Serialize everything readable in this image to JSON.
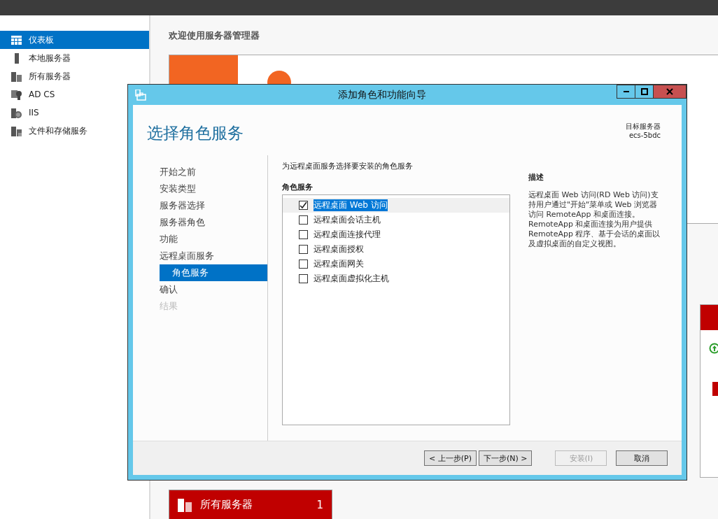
{
  "sidebar": {
    "items": [
      {
        "label": "仪表板",
        "selected": true
      },
      {
        "label": "本地服务器",
        "selected": false
      },
      {
        "label": "所有服务器",
        "selected": false
      },
      {
        "label": "AD CS",
        "selected": false
      },
      {
        "label": "IIS",
        "selected": false
      },
      {
        "label": "文件和存储服务",
        "selected": false
      }
    ]
  },
  "welcome": {
    "title": "欢迎使用服务器管理器"
  },
  "tiles": [
    {
      "title": "所有服务器",
      "count": "1"
    }
  ],
  "dialog": {
    "title": "添加角色和功能向导",
    "heading": "选择角色服务",
    "target_label": "目标服务器",
    "target_server": "ecs-5bdc",
    "nav": [
      {
        "label": "开始之前",
        "selected": false,
        "disabled": false
      },
      {
        "label": "安装类型",
        "selected": false,
        "disabled": false
      },
      {
        "label": "服务器选择",
        "selected": false,
        "disabled": false
      },
      {
        "label": "服务器角色",
        "selected": false,
        "disabled": false
      },
      {
        "label": "功能",
        "selected": false,
        "disabled": false
      },
      {
        "label": "远程桌面服务",
        "selected": false,
        "disabled": false,
        "children": [
          {
            "label": "角色服务",
            "selected": true,
            "disabled": false
          }
        ]
      },
      {
        "label": "确认",
        "selected": false,
        "disabled": false
      },
      {
        "label": "结果",
        "selected": false,
        "disabled": true
      }
    ],
    "instruction": "为远程桌面服务选择要安装的角色服务",
    "list_heading": "角色服务",
    "roles": [
      {
        "label": "远程桌面 Web 访问",
        "checked": true,
        "selected": true
      },
      {
        "label": "远程桌面会话主机",
        "checked": false,
        "selected": false
      },
      {
        "label": "远程桌面连接代理",
        "checked": false,
        "selected": false
      },
      {
        "label": "远程桌面授权",
        "checked": false,
        "selected": false
      },
      {
        "label": "远程桌面网关",
        "checked": false,
        "selected": false
      },
      {
        "label": "远程桌面虚拟化主机",
        "checked": false,
        "selected": false
      }
    ],
    "description_heading": "描述",
    "description": "远程桌面 Web 访问(RD Web 访问)支持用户通过\"开始\"菜单或 Web 浏览器访问 RemoteApp 和桌面连接。RemoteApp 和桌面连接为用户提供 RemoteApp 程序、基于会话的桌面以及虚拟桌面的自定义视图。",
    "buttons": [
      {
        "label": "< 上一步(P)",
        "disabled": false
      },
      {
        "label": "下一步(N) >",
        "disabled": false
      },
      {
        "label": "安装(I)",
        "disabled": true
      },
      {
        "label": "取消",
        "disabled": false
      }
    ]
  }
}
